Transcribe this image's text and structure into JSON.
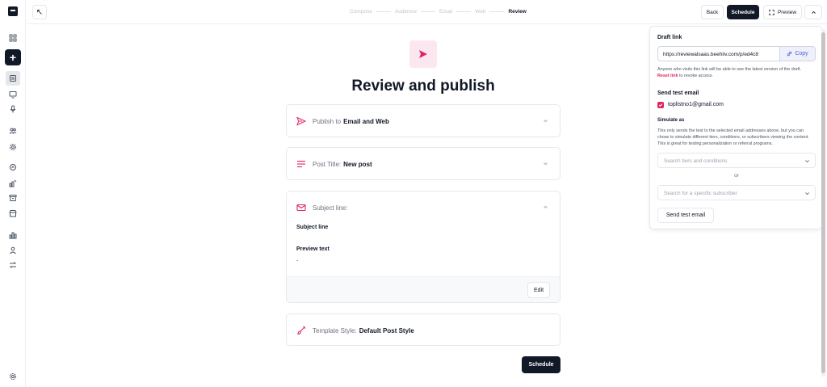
{
  "topbar": {
    "steps": [
      "Compose",
      "Audience",
      "Email",
      "Web",
      "Review"
    ],
    "current_step": "Review",
    "back_label": "Back",
    "schedule_label": "Schedule",
    "preview_label": "Preview"
  },
  "main": {
    "title": "Review and publish",
    "publish_card": {
      "prefix": "Publish to",
      "value": "Email and Web"
    },
    "post_title_card": {
      "prefix": "Post Title:",
      "value": "New post"
    },
    "subject_card": {
      "prefix": "Subject line:",
      "subject_label": "Subject line",
      "preview_label": "Preview text",
      "preview_value": "-",
      "edit_label": "Edit"
    },
    "template_card": {
      "prefix": "Template Style:",
      "value": "Default Post Style"
    },
    "schedule_label": "Schedule"
  },
  "panel": {
    "draft_link_label": "Draft link",
    "draft_url": "https://reviewalsaas.beehiiv.com/p/ed4c8",
    "copy_label": "Copy",
    "draft_note_before": "Anyone who visits this link will be able to see the latest version of the draft.",
    "reset_link_label": "Reset link",
    "draft_note_after": "to revoke access.",
    "send_test_label": "Send test email",
    "test_email": "toplistno1@gmail.com",
    "simulate_label": "Simulate as",
    "simulate_note": "This only sends the test to the selected email addresses above, but you can chose to simulate different tiers, conditions, or subscribers viewing the content. This is great for testing personalization or referral programs.",
    "tiers_placeholder": "Search tiers and conditions",
    "or_label": "or",
    "subscriber_placeholder": "Search for a specific subscriber",
    "send_button_label": "Send test email"
  },
  "colors": {
    "accent": "#e0245e",
    "dark": "#111827",
    "copy_blue": "#4f5bd5"
  }
}
